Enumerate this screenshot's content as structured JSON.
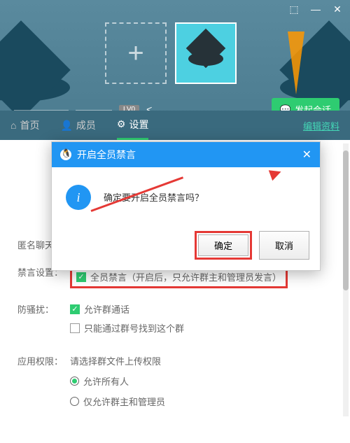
{
  "titlebar": {
    "pin": "⬚",
    "min": "—",
    "close": "✕"
  },
  "header": {
    "add_avatar": "+",
    "group_name": "▬▬▬▬▬▬",
    "group_id": "▬▬▬▬",
    "level_badge": "LV0",
    "start_chat": "发起会话"
  },
  "tabs": {
    "home": "首页",
    "members": "成员",
    "settings": "设置",
    "edit": "编辑资料"
  },
  "settings": {
    "anonymous_label": "匿名聊天",
    "mute_label": "禁言设置：",
    "mute_all_text": "全员禁言（开启后，只允许群主和管理员发言）",
    "anti_harass_label": "防骚扰：",
    "allow_call": "允许群通话",
    "only_group_id": "只能通过群号找到这个群",
    "permission_label": "应用权限：",
    "permission_hint": "请选择群文件上传权限",
    "allow_all": "允许所有人",
    "only_admin": "仅允许群主和管理员"
  },
  "dialog": {
    "title": "开启全员禁言",
    "message": "确定要开启全员禁言吗？",
    "confirm": "确定",
    "cancel": "取消"
  }
}
